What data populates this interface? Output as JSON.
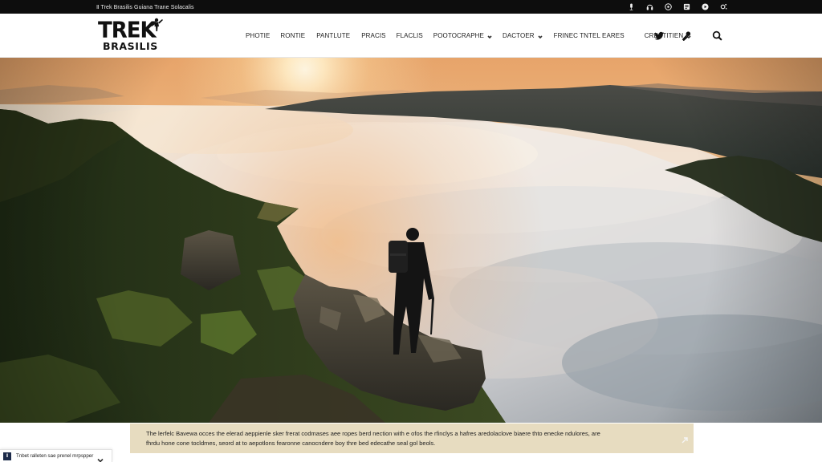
{
  "topbar": {
    "text": "Ⅱ Trek Brasilis Guiana Trane Solacalis",
    "icons": [
      "microphone-icon",
      "headphones-icon",
      "whatsapp-icon",
      "document-icon",
      "user-circle-icon",
      "sparkle-icon"
    ]
  },
  "brand": {
    "line1": "TREK",
    "line2": "BRASILIS"
  },
  "nav": {
    "items": [
      {
        "label": "PHOTIE",
        "has_dropdown": false
      },
      {
        "label": "RONTIE",
        "has_dropdown": false
      },
      {
        "label": "PANTLUTE",
        "has_dropdown": false
      },
      {
        "label": "PRACIS",
        "has_dropdown": false
      },
      {
        "label": "FLACLIS",
        "has_dropdown": false
      },
      {
        "label": "POOTOCRAPHE",
        "has_dropdown": true
      },
      {
        "label": "DACTOER",
        "has_dropdown": true
      },
      {
        "label": "FRINEC TNTEL EARES",
        "has_dropdown": false
      },
      {
        "label": "CRESTITIEN",
        "has_dropdown": true
      }
    ]
  },
  "header_icons": [
    "twitter-icon",
    "microphone-icon",
    "search-icon"
  ],
  "hero": {
    "scene": "hiker-on-ridge-above-sea-of-clouds"
  },
  "caption": {
    "line1": "The lerfelc Bavewa occes the elerad aeppienle sker frerat codmases aee ropes berd nection with e ofos the rfinclys a hafres aredolaclove biaere thto enecke ndulores, are",
    "line2": "fhrdu hone cone tocldmes, seord at to aepotlons fearonne canocndere boy thre bed edecathe seal gol beols."
  },
  "footer_tab": {
    "badge": "Ⅱ",
    "label": "Tnbet ralleten sae prenel mrpspper"
  },
  "colors": {
    "topbar_bg": "#0d0d0d",
    "caption_bg": "#e7dcc0",
    "text_dark": "#111111",
    "sky_warm": "#f0a45c",
    "cloud": "#e9e6e3"
  }
}
